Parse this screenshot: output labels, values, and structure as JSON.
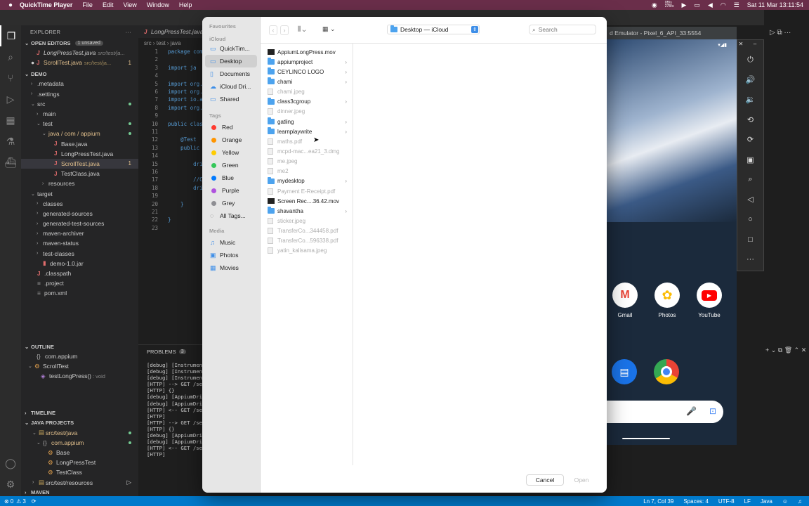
{
  "menubar": {
    "app": "QuickTime Player",
    "items": [
      "File",
      "Edit",
      "View",
      "Window",
      "Help"
    ],
    "clock": "Sat 11 Mar  13:11:54",
    "net": "0B/s\n27B/s"
  },
  "vscode": {
    "explorer_title": "EXPLORER",
    "open_editors": "OPEN EDITORS",
    "unsaved_badge": "1 unsaved",
    "open_files": [
      {
        "name": "LongPressTest.java",
        "path": "src/test/ja..."
      },
      {
        "name": "ScrollTest.java",
        "path": "src/test/ja...",
        "badge": "1"
      }
    ],
    "project": "DEMO",
    "tree": [
      {
        "label": ".metadata",
        "indent": 1,
        "kind": "folder",
        "chev": "›"
      },
      {
        "label": ".settings",
        "indent": 1,
        "kind": "folder",
        "chev": "›"
      },
      {
        "label": "src",
        "indent": 1,
        "kind": "folder",
        "chev": "⌄",
        "dot": true
      },
      {
        "label": "main",
        "indent": 2,
        "kind": "folder",
        "chev": "›"
      },
      {
        "label": "test",
        "indent": 2,
        "kind": "folder",
        "chev": "⌄",
        "dot": true
      },
      {
        "label": "java / com / appium",
        "indent": 3,
        "kind": "folder",
        "chev": "⌄",
        "dot": true,
        "mod": true
      },
      {
        "label": "Base.java",
        "indent": 4,
        "kind": "java"
      },
      {
        "label": "LongPressTest.java",
        "indent": 4,
        "kind": "java"
      },
      {
        "label": "ScrollTest.java",
        "indent": 4,
        "kind": "java",
        "sel": true,
        "badge": "1",
        "mod": true
      },
      {
        "label": "TestClass.java",
        "indent": 4,
        "kind": "java"
      },
      {
        "label": "resources",
        "indent": 3,
        "kind": "folder",
        "chev": "›"
      },
      {
        "label": "target",
        "indent": 1,
        "kind": "folder",
        "chev": "⌄"
      },
      {
        "label": "classes",
        "indent": 2,
        "kind": "folder",
        "chev": "›"
      },
      {
        "label": "generated-sources",
        "indent": 2,
        "kind": "folder",
        "chev": "›"
      },
      {
        "label": "generated-test-sources",
        "indent": 2,
        "kind": "folder",
        "chev": "›"
      },
      {
        "label": "maven-archiver",
        "indent": 2,
        "kind": "folder",
        "chev": "›"
      },
      {
        "label": "maven-status",
        "indent": 2,
        "kind": "folder",
        "chev": "›"
      },
      {
        "label": "test-classes",
        "indent": 2,
        "kind": "folder",
        "chev": "›"
      },
      {
        "label": "demo-1.0.jar",
        "indent": 2,
        "kind": "jar"
      },
      {
        "label": ".classpath",
        "indent": 1,
        "kind": "java"
      },
      {
        "label": ".project",
        "indent": 1,
        "kind": "file"
      },
      {
        "label": "pom.xml",
        "indent": 1,
        "kind": "file"
      }
    ],
    "outline": "OUTLINE",
    "outline_items": [
      "com.appium",
      "ScrollTest",
      "testLongPress()"
    ],
    "outline_void": ": void",
    "timeline": "TIMELINE",
    "java_projects": "JAVA PROJECTS",
    "jp_items": [
      "src/test/java",
      "com.appium",
      "Base",
      "LongPressTest",
      "TestClass",
      "src/test/resources"
    ],
    "maven": "MAVEN",
    "editor_tab": "LongPressTest.java",
    "breadcrumb": "src › test › java",
    "code_lines": [
      "package com",
      "",
      "import ja",
      "",
      "import org.",
      "import org.",
      "import io.a",
      "import org.",
      "",
      "public clas",
      "",
      "    @Test",
      "    public",
      "",
      "        dri",
      "",
      "        //C",
      "        dri",
      "",
      "    }",
      "",
      "}",
      ""
    ],
    "panel_tab": "PROBLEMS",
    "panel_badge": "3",
    "terminal": [
      "[debug] [Instrumen",
      "[debug] [Instrumen",
      "[debug] [Instrumen",
      "[HTTP] --> GET /se",
      "[HTTP] {}",
      "[debug] [AppiumDri",
      "[debug] [AppiumDri",
      "[HTTP] <-- GET /se",
      "[HTTP]",
      "[HTTP] --> GET /se",
      "[HTTP] {}",
      "[debug] [AppiumDri",
      "[debug] [AppiumDri",
      "[HTTP] <-- GET /se",
      "[HTTP]"
    ],
    "status": {
      "errors": "0",
      "warnings": "3",
      "position": "Ln 7, Col 39",
      "spaces": "Spaces: 4",
      "encoding": "UTF-8",
      "eol": "LF",
      "lang": "Java"
    }
  },
  "emulator": {
    "title": "d Emulator - Pixel_6_API_33:5554",
    "apps": [
      "Gmail",
      "Photos",
      "YouTube"
    ]
  },
  "dialog": {
    "sidebar": {
      "favourites_header": "Favourites",
      "favourites": [
        "QuickTim...",
        "Desktop",
        "Documents"
      ],
      "icloud_header": "iCloud",
      "icloud": [
        "iCloud Dri...",
        "Shared"
      ],
      "tags_header": "Tags",
      "tags": [
        {
          "label": "Red",
          "color": "#ff3b30"
        },
        {
          "label": "Orange",
          "color": "#ff9500"
        },
        {
          "label": "Yellow",
          "color": "#ffcc00"
        },
        {
          "label": "Green",
          "color": "#34c759"
        },
        {
          "label": "Blue",
          "color": "#007aff"
        },
        {
          "label": "Purple",
          "color": "#af52de"
        },
        {
          "label": "Grey",
          "color": "#8e8e93"
        }
      ],
      "all_tags": "All Tags...",
      "media_header": "Media",
      "media": [
        "Music",
        "Photos",
        "Movies"
      ]
    },
    "location": "Desktop — iCloud",
    "search_placeholder": "Search",
    "files": [
      {
        "name": "AppiumLongPress.mov",
        "kind": "mov"
      },
      {
        "name": "appiumproject",
        "kind": "folder",
        "arrow": true
      },
      {
        "name": "CEYLINCO LOGO",
        "kind": "folder",
        "arrow": true
      },
      {
        "name": "chami",
        "kind": "folder",
        "arrow": true
      },
      {
        "name": "chami.jpeg",
        "kind": "file",
        "dim": true
      },
      {
        "name": "class3cgroup",
        "kind": "folder",
        "arrow": true
      },
      {
        "name": "dinner.jpeg",
        "kind": "file",
        "dim": true
      },
      {
        "name": "gatling",
        "kind": "folder",
        "arrow": true
      },
      {
        "name": "learnplaywrite",
        "kind": "folder",
        "arrow": true
      },
      {
        "name": "maths.pdf",
        "kind": "file",
        "dim": true
      },
      {
        "name": "mcpd-mac...ea21_3.dmg",
        "kind": "file",
        "dim": true
      },
      {
        "name": "me.jpeg",
        "kind": "file",
        "dim": true
      },
      {
        "name": "me2",
        "kind": "file",
        "dim": true
      },
      {
        "name": "mydesktop",
        "kind": "folder",
        "arrow": true
      },
      {
        "name": "Payment E-Receipt.pdf",
        "kind": "file",
        "dim": true
      },
      {
        "name": "Screen Rec....36.42.mov",
        "kind": "mov"
      },
      {
        "name": "shavantha",
        "kind": "folder",
        "arrow": true
      },
      {
        "name": "sticker.jpeg",
        "kind": "file",
        "dim": true
      },
      {
        "name": "TransferCo...344458.pdf",
        "kind": "file",
        "dim": true
      },
      {
        "name": "TransferCo...596338.pdf",
        "kind": "file",
        "dim": true
      },
      {
        "name": "yatin_kalisama.jpeg",
        "kind": "file",
        "dim": true
      }
    ],
    "cancel": "Cancel",
    "open": "Open"
  }
}
